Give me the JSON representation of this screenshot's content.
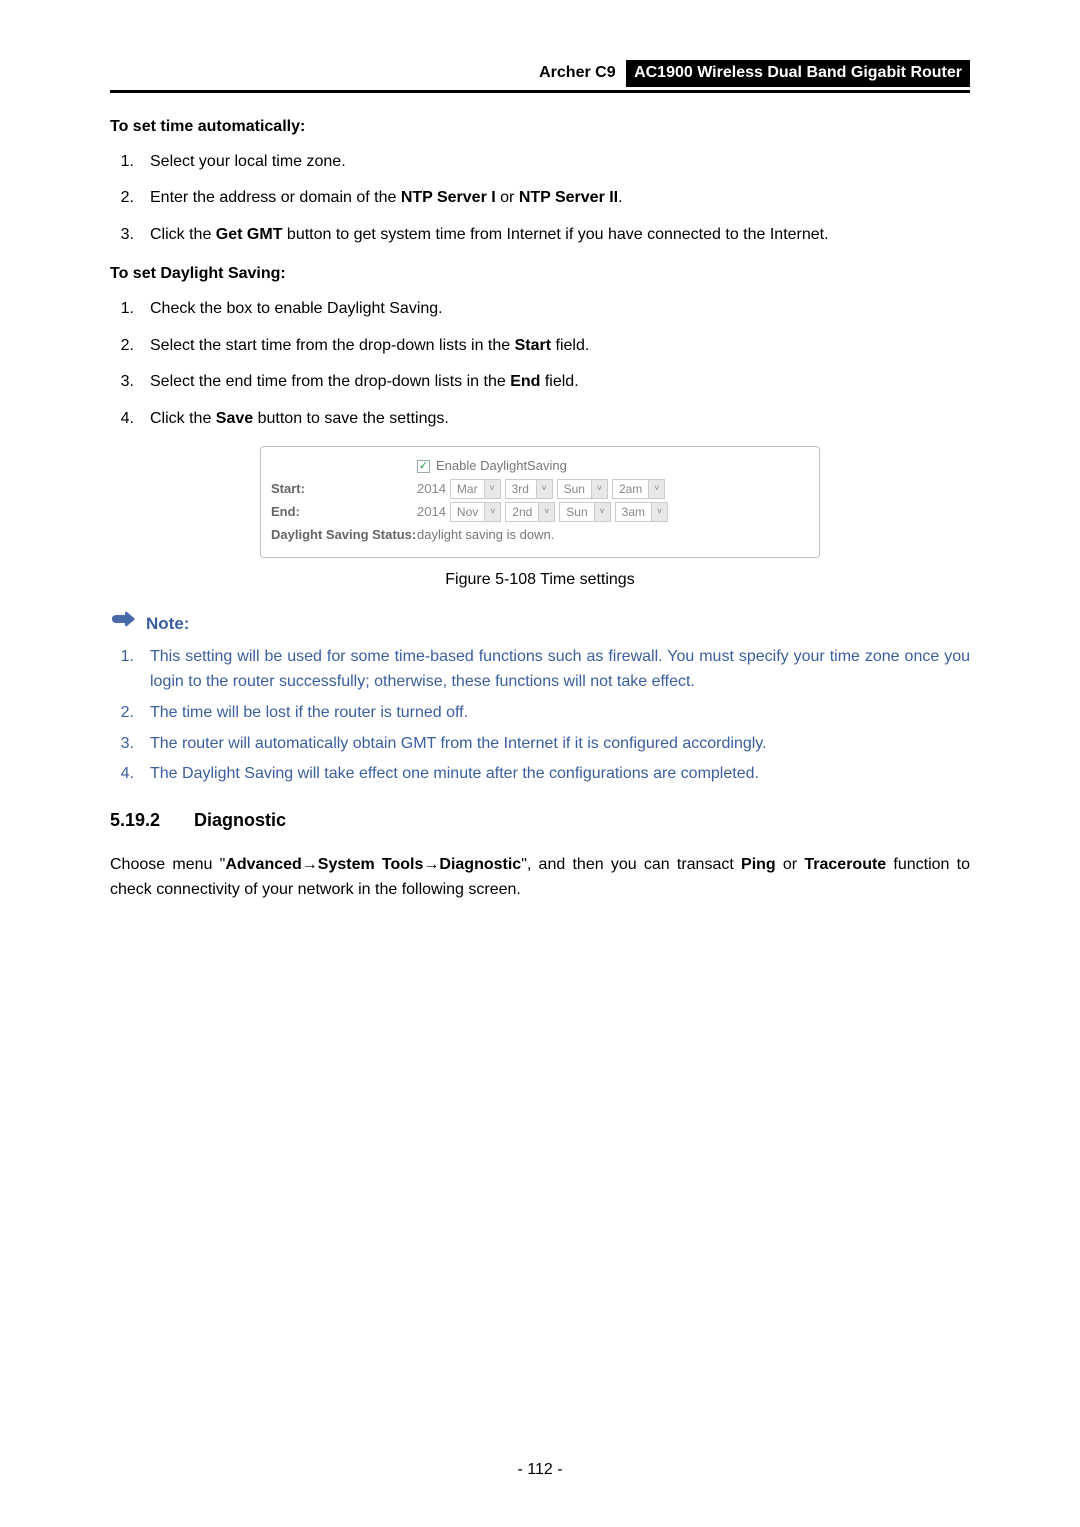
{
  "header": {
    "model": "Archer C9",
    "title": "AC1900 Wireless Dual Band Gigabit Router"
  },
  "auto_time": {
    "heading": "To set time automatically:",
    "items": [
      {
        "num": "1.",
        "text_a": "Select your local time zone."
      },
      {
        "num": "2.",
        "text_a": "Enter the address or domain of the ",
        "b1": "NTP Server I",
        "mid": " or ",
        "b2": "NTP Server II",
        "text_end": "."
      },
      {
        "num": "3.",
        "text_a": "Click the ",
        "b1": "Get GMT",
        "text_b": " button to get system time from Internet if you have connected to the Internet."
      }
    ]
  },
  "daylight": {
    "heading": "To set Daylight Saving:",
    "items": [
      {
        "num": "1.",
        "text_a": "Check the box to enable Daylight Saving."
      },
      {
        "num": "2.",
        "text_a": "Select the start time from the drop-down lists in the ",
        "b1": "Start",
        "text_end": " field."
      },
      {
        "num": "3.",
        "text_a": "Select the end time from the drop-down lists in the ",
        "b1": "End",
        "text_end": " field."
      },
      {
        "num": "4.",
        "text_a": "Click the ",
        "b1": "Save",
        "text_end": " button to save the settings."
      }
    ]
  },
  "ds_panel": {
    "enable_label": "Enable DaylightSaving",
    "checked": "✓",
    "start_label": "Start:",
    "end_label": "End:",
    "status_label": "Daylight Saving Status:",
    "status_value": "daylight saving is down.",
    "start": {
      "year": "2014",
      "month": "Mar",
      "week": "3rd",
      "day": "Sun",
      "hour": "2am"
    },
    "end": {
      "year": "2014",
      "month": "Nov",
      "week": "2nd",
      "day": "Sun",
      "hour": "3am"
    },
    "caret": "˅"
  },
  "figure_caption": "Figure 5-108 Time settings",
  "note": {
    "label": "Note:",
    "items": [
      {
        "num": "1.",
        "text": "This setting will be used for some time-based functions such as firewall. You must specify your time zone once you login to the router successfully; otherwise, these functions will not take effect."
      },
      {
        "num": "2.",
        "text": "The time will be lost if the router is turned off."
      },
      {
        "num": "3.",
        "text": "The router will automatically obtain GMT from the Internet if it is configured accordingly."
      },
      {
        "num": "4.",
        "text": "The Daylight Saving will take effect one minute after the configurations are completed."
      }
    ]
  },
  "section": {
    "num": "5.19.2",
    "title": "Diagnostic"
  },
  "diag_para": {
    "a": "Choose menu \"",
    "b1": "Advanced",
    "arrow1": "→",
    "b2": "System Tools",
    "arrow2": "→",
    "b3": "Diagnostic",
    "c": "\", and then you can transact ",
    "b4": "Ping",
    "d": " or ",
    "b5": "Traceroute",
    "e": " function to check connectivity of your network in the following screen."
  },
  "page_number": "- 112 -"
}
